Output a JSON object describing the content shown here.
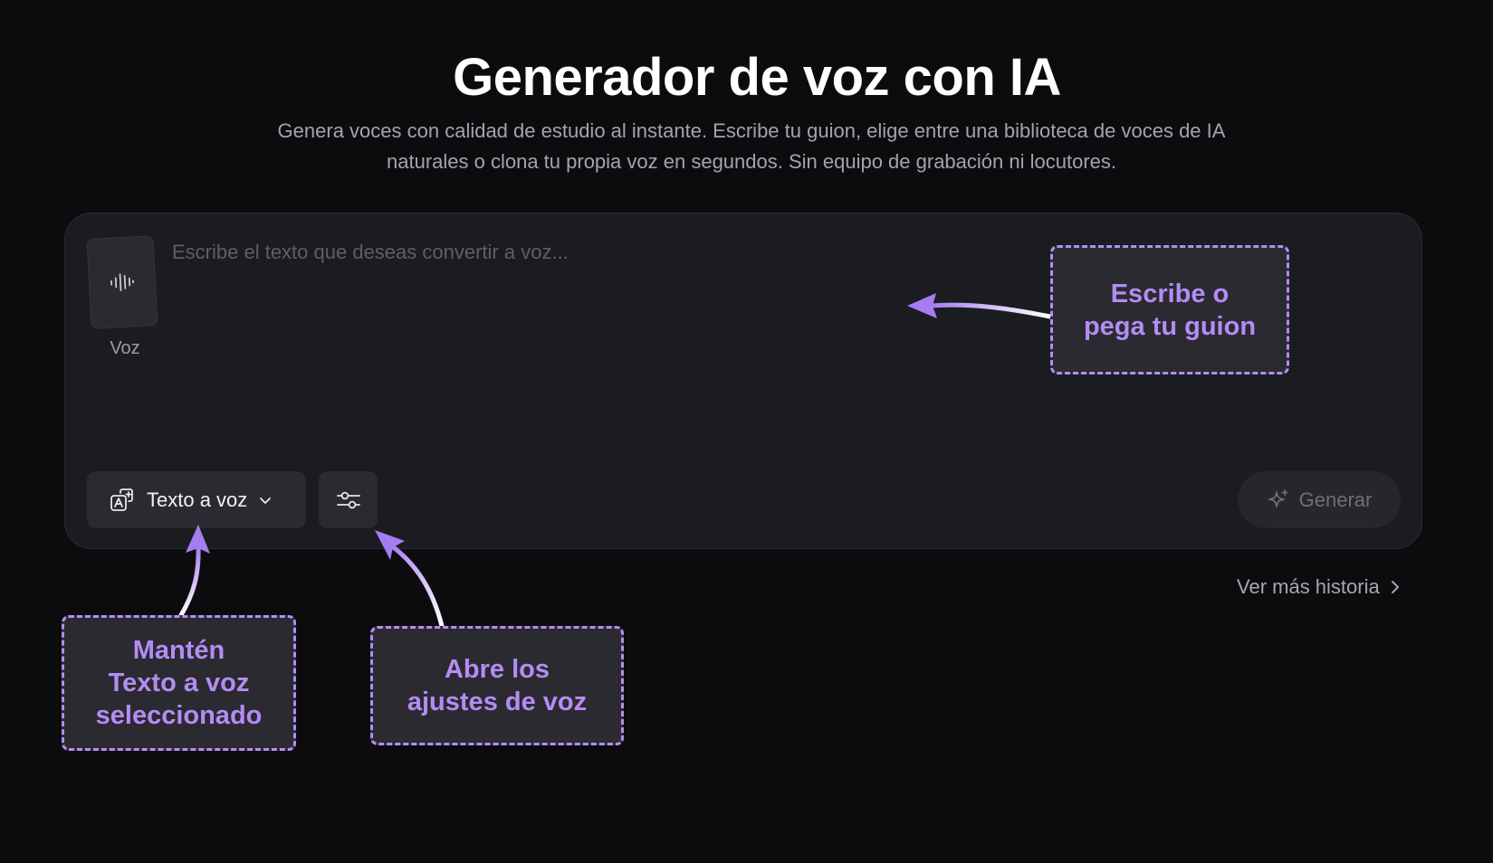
{
  "page": {
    "title": "Generador de voz con IA",
    "subtitle": "Genera voces con calidad de estudio al instante. Escribe tu guion, elige entre una biblioteca de voces de IA naturales o clona tu propia voz en segundos. Sin equipo de grabación ni locutores."
  },
  "editor": {
    "voice_label": "Voz",
    "voice_icon": "waveform-icon",
    "input_placeholder": "Escribe el texto que deseas convertir a voz...",
    "input_value": ""
  },
  "toolbar": {
    "mode_label": "Texto a voz",
    "mode_icon": "text-to-speech-icon",
    "settings_icon": "sliders-icon",
    "generate_label": "Generar",
    "generate_icon": "sparkle-icon"
  },
  "history": {
    "link_label": "Ver más historia"
  },
  "annotations": {
    "accent_color": "#b48cf5",
    "script_callout": "Escribe o\npega tu guion",
    "mode_callout": "Mantén\nTexto a voz\nseleccionado",
    "settings_callout": "Abre los\najustes de voz"
  }
}
